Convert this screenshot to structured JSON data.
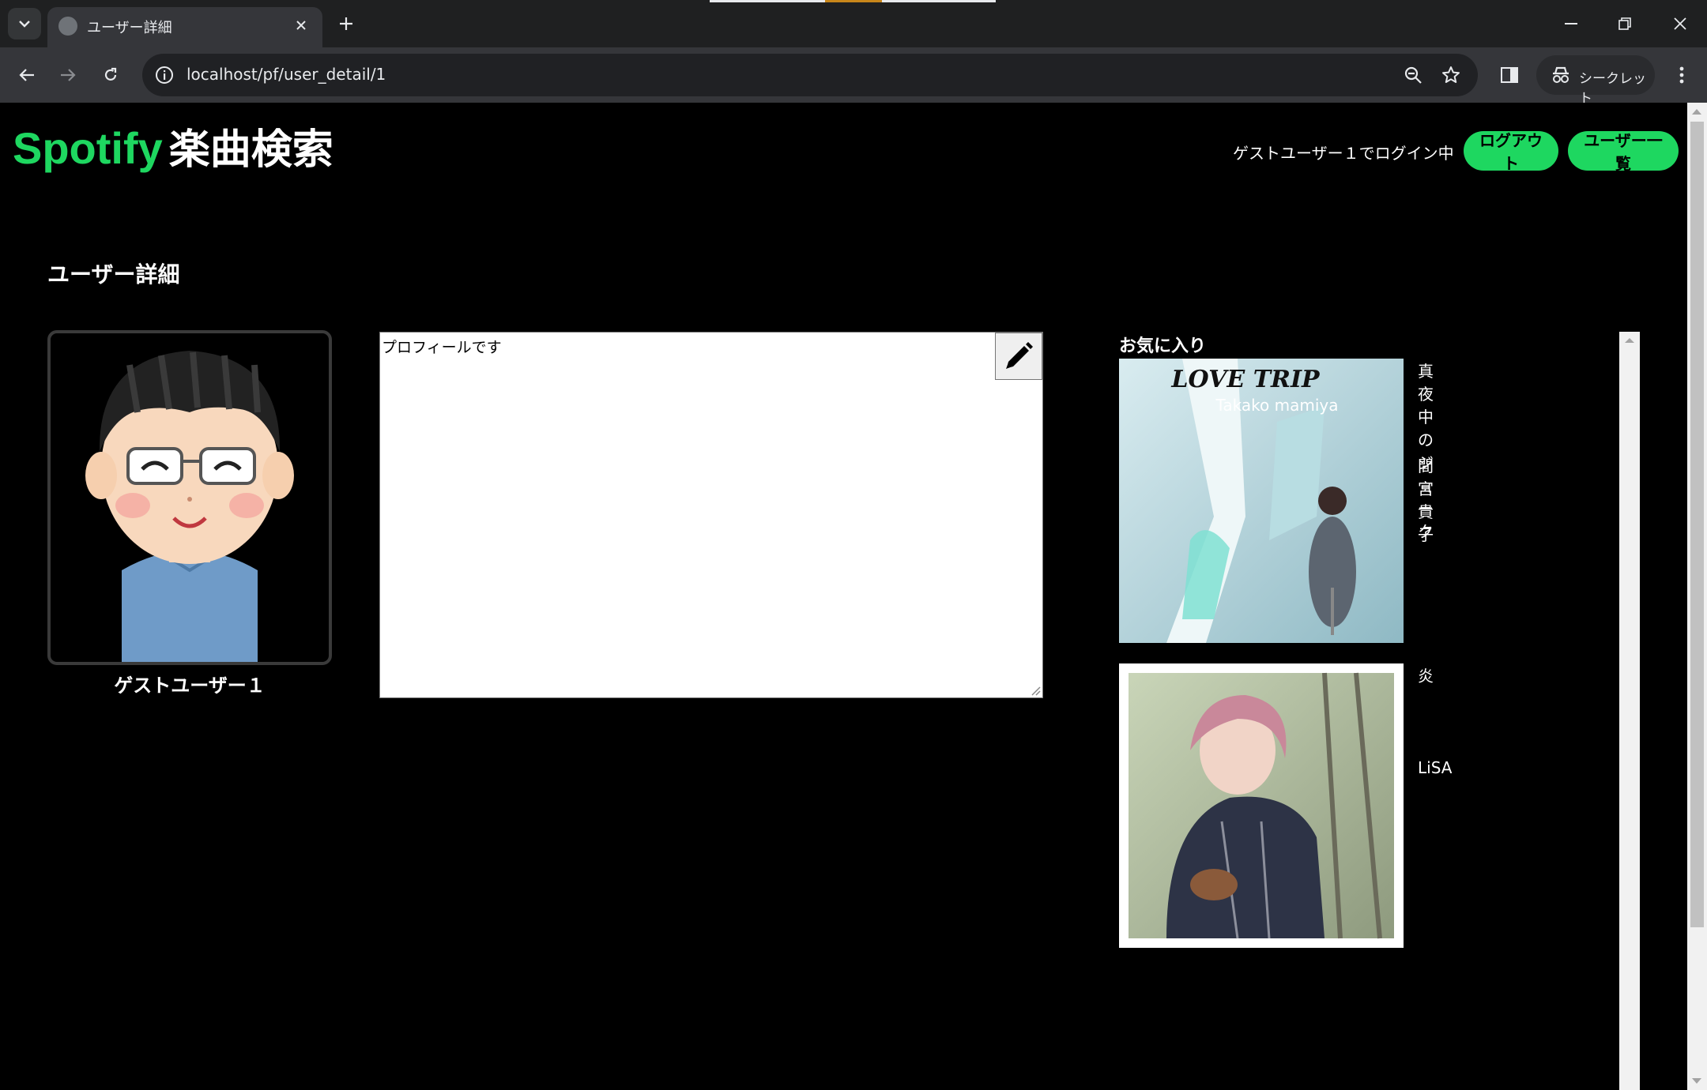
{
  "browser": {
    "tab_title": "ユーザー詳細",
    "url": "localhost/pf/user_detail/1",
    "incognito_label": "シークレット"
  },
  "header": {
    "brand": "Spotify",
    "title": "楽曲検索",
    "login_status": "ゲストユーザー１でログイン中",
    "logout_label": "ログアウト",
    "user_list_label": "ユーザー一覧"
  },
  "main": {
    "section_title": "ユーザー詳細",
    "user_name": "ゲストユーザー１",
    "profile_text": "プロフィールです"
  },
  "favorites": {
    "title": "お気に入り",
    "tracks": [
      {
        "name": "真夜中のジョーク",
        "artist": "間宮貴子",
        "cover_text": "LOVE TRIP",
        "cover_subtext": "Takako mamiya"
      },
      {
        "name": "炎",
        "artist": "LiSA"
      }
    ]
  },
  "colors": {
    "accent": "#1ed760",
    "background": "#000000"
  }
}
